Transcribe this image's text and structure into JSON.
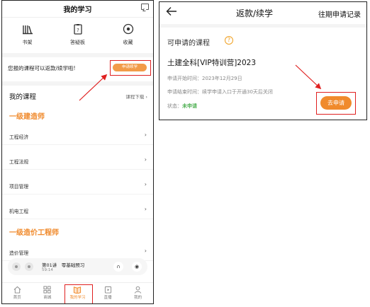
{
  "left": {
    "header": {
      "title": "我的学习"
    },
    "quick_links": [
      {
        "label": "书架",
        "icon": "bookshelf-icon"
      },
      {
        "label": "答疑板",
        "icon": "qa-board-icon"
      },
      {
        "label": "收藏",
        "icon": "favorite-icon"
      }
    ],
    "refund_notice": {
      "text": "您报的课程可以返款/续学啦!",
      "button": "申请续学"
    },
    "my_courses": {
      "title": "我的课程",
      "download": "课程下载"
    },
    "categories": [
      {
        "title": "一级建造师",
        "items": [
          "工程经济",
          "工程法规",
          "项目管理",
          "机电工程"
        ]
      },
      {
        "title": "一级造价工程师",
        "items": [
          "造价管理"
        ]
      }
    ],
    "chevron": "›",
    "mini_player": {
      "title": "第01讲　零基础预习",
      "time": "59:14"
    },
    "tabbar": [
      {
        "label": "首页",
        "icon": "home-icon"
      },
      {
        "label": "商城",
        "icon": "grid-icon"
      },
      {
        "label": "我的学习",
        "icon": "book-open-icon",
        "active": true
      },
      {
        "label": "直播",
        "icon": "live-icon"
      },
      {
        "label": "我的",
        "icon": "user-icon"
      }
    ]
  },
  "right": {
    "header": {
      "title": "返款/续学",
      "history": "往期申请记录"
    },
    "section_title": "可申请的课程",
    "help_glyph": "?",
    "course": {
      "name": "土建全科[VIP特训营]2023",
      "start_label": "申请开始时间：",
      "start_value": "2023年12月29日",
      "end_label": "申请结束时间：",
      "end_value": "续学申请入口于开通30天后关闭",
      "status_label": "状态：",
      "status_value": "未申请"
    },
    "apply_button": "去申请"
  },
  "colors": {
    "accent": "#f08a2c",
    "highlight_box": "#e02020",
    "status_green": "#4caf50"
  }
}
